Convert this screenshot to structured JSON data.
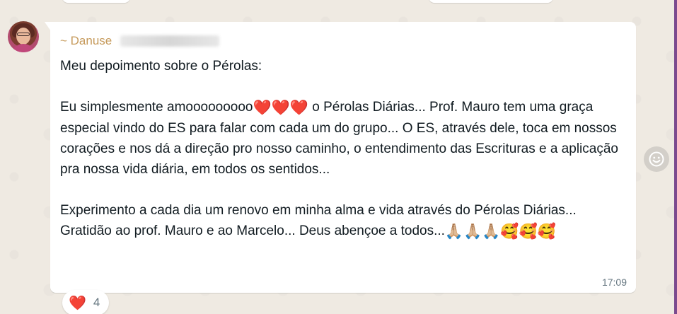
{
  "chat": {
    "message": {
      "sender_name": "~ Danuse",
      "line_title": "Meu depoimento sobre o Pérolas:",
      "p1_text_a": "Eu simplesmente amooooooooo",
      "p1_hearts": "❤️❤️❤️",
      "p1_text_b": " o Pérolas Diárias... Prof. Mauro tem uma graça especial vindo do ES para falar com cada um do grupo... O ES, através dele, toca em nossos corações e nos dá a direção pro nosso caminho, o entendimento das Escrituras e a aplicação pra nossa vida diária, em todos os sentidos...",
      "p2_text": "Experimento a cada dia um renovo em minha alma e vida através do Pérolas Diárias... Gratidão ao prof. Mauro e ao Marcelo... Deus abençoe a todos...",
      "p2_emojis": "🙏🏼🙏🏼🙏🏼🥰🥰🥰",
      "time": "17:09"
    },
    "reaction": {
      "emoji": "❤️",
      "count": "4"
    },
    "icons": {
      "react_button": "smiley-face-icon",
      "avatar": "user-avatar"
    },
    "colors": {
      "background": "#efeae2",
      "bubble": "#ffffff",
      "sender": "#c69a5b",
      "text": "#111b21",
      "meta": "#667781"
    }
  }
}
